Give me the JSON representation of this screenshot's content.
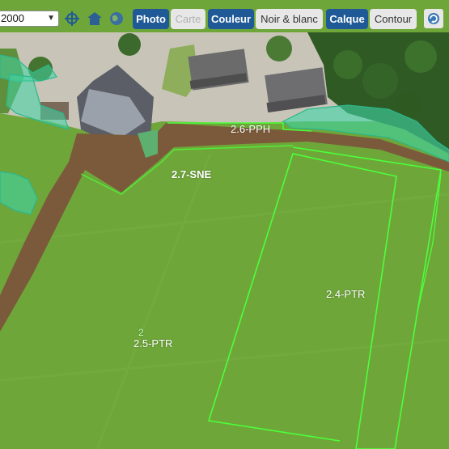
{
  "toolbar": {
    "scale_value": "2000",
    "photo_label": "Photo",
    "carte_label": "Carte",
    "couleur_label": "Couleur",
    "noir_blanc_label": "Noir & blanc",
    "calque_label": "Calque",
    "contour_label": "Contour"
  },
  "icons": {
    "locate": "crosshair-icon",
    "home": "home-icon",
    "globe": "globe-icon",
    "refresh": "refresh-icon"
  },
  "colors": {
    "active_button": "#1f5a96",
    "field_green": "#6fa63a",
    "track_brown": "#7a5a3a",
    "parcel_outline": "#4cff3a",
    "hedge_teal": "#3fd6a6"
  },
  "parcels": {
    "ptr_2_4": "2.4-PTR",
    "ptr_2_5": "2.5-PTR",
    "ptr_2_5_number": "2",
    "pph_2_6": "2.6-PPH",
    "sne_2_7": "2.7-SNE"
  }
}
